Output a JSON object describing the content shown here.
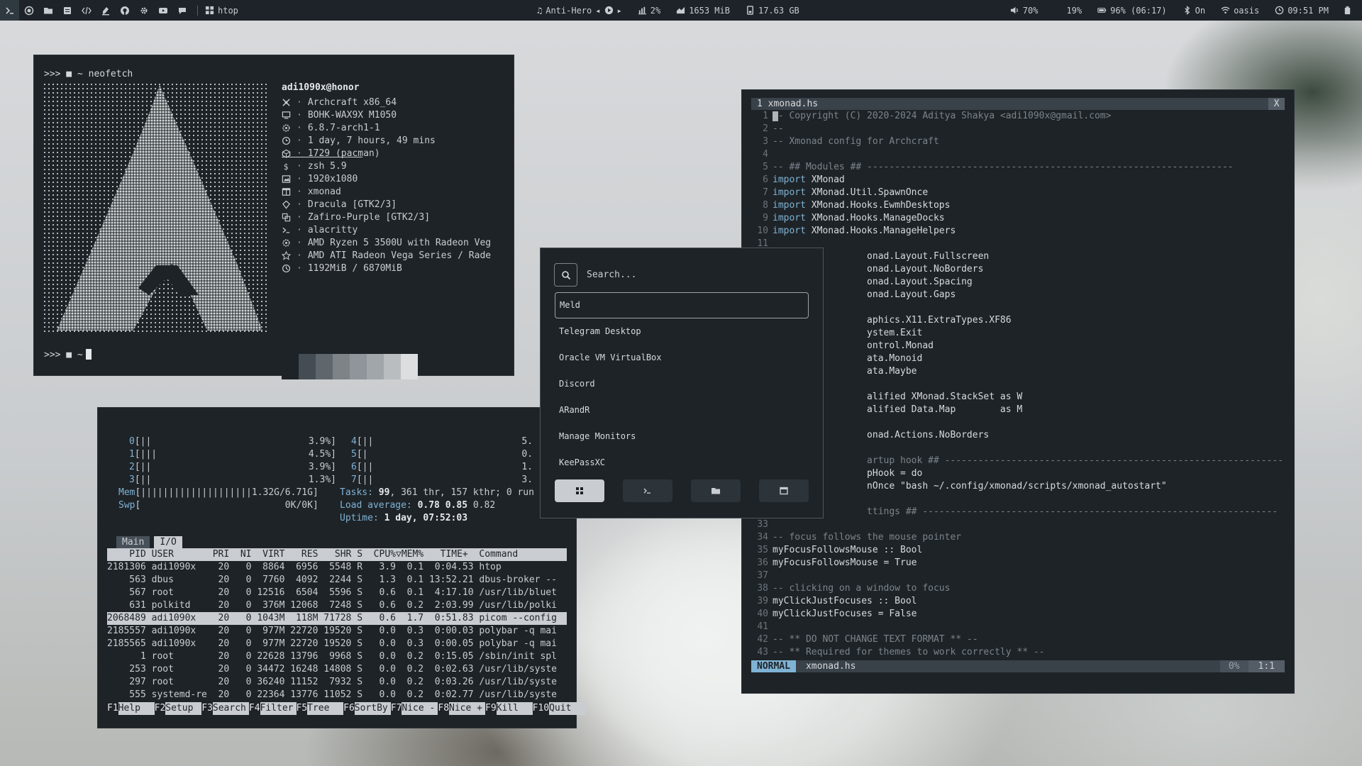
{
  "topbar": {
    "workspace_label": "htop",
    "music_track": "Anti-Hero",
    "cpu": "2%",
    "memory": "1653 MiB",
    "disk": "17.63 GB",
    "volume": "70%",
    "brightness": "19%",
    "battery": "96% (06:17)",
    "bluetooth": "On",
    "wifi": "oasis",
    "clock": "09:51 PM"
  },
  "neofetch": {
    "prompt_cmd": ">>> ■ ~ neofetch",
    "prompt_after": ">>> ■ ~",
    "user_host": "adi1090x@honor",
    "info": [
      {
        "icon": "os-icon",
        "value": "Archcraft x86_64"
      },
      {
        "icon": "host-icon",
        "value": "BOHK-WAX9X M1050"
      },
      {
        "icon": "kernel-icon",
        "value": "6.8.7-arch1-1"
      },
      {
        "icon": "uptime-icon",
        "value": "1 day, 7 hours, 49 mins"
      },
      {
        "icon": "packages-icon",
        "value": "1729 (pacman)"
      },
      {
        "icon": "shell-icon",
        "value": "zsh 5.9"
      },
      {
        "icon": "resolution-icon",
        "value": "1920x1080"
      },
      {
        "icon": "wm-icon",
        "value": "xmonad"
      },
      {
        "icon": "theme-icon",
        "value": "Dracula [GTK2/3]"
      },
      {
        "icon": "icons-icon",
        "value": "Zafiro-Purple [GTK2/3]"
      },
      {
        "icon": "terminal-icon",
        "value": "alacritty"
      },
      {
        "icon": "cpu-icon",
        "value": "AMD Ryzen 5 3500U with Radeon Veg"
      },
      {
        "icon": "gpu-icon",
        "value": "AMD ATI Radeon Vega Series / Rade"
      },
      {
        "icon": "memory-icon",
        "value": "1192MiB / 6870MiB"
      }
    ],
    "palette": [
      "#1e2327",
      "#454d54",
      "#5f676d",
      "#7d8387",
      "#8f959b",
      "#a1a6aa",
      "#babdbf",
      "#dcdedf"
    ]
  },
  "htop": {
    "cpus_left": [
      {
        "id": "0",
        "bar": "[||",
        "pct": "3.9%]"
      },
      {
        "id": "1",
        "bar": "[|||",
        "pct": "4.5%]"
      },
      {
        "id": "2",
        "bar": "[||",
        "pct": "3.9%]"
      },
      {
        "id": "3",
        "bar": "[||",
        "pct": "1.3%]"
      }
    ],
    "cpus_right": [
      {
        "id": "4",
        "bar": "[||",
        "pct": "5."
      },
      {
        "id": "5",
        "bar": "[|",
        "pct": "0."
      },
      {
        "id": "6",
        "bar": "[||",
        "pct": "1."
      },
      {
        "id": "7",
        "bar": "[||",
        "pct": "3."
      }
    ],
    "mem_label": "Mem",
    "mem_bar": "[||||||||||||||||||||1.32G/6.71G]",
    "swp_label": "Swp",
    "swp_bar": "[                          0K/0K]",
    "tasks_label": "Tasks:",
    "tasks_count": "99",
    "tasks_rest": ", 361 thr, 157 kthr; 0 run",
    "load_label": "Load average:",
    "load_1": "0.78",
    "load_5": "0.85",
    "load_15": "0.82",
    "uptime_label": "Uptime:",
    "uptime_value": "1 day, 07:52:03",
    "tab_main": "Main",
    "tab_io": "I/O",
    "header": "    PID USER       PRI  NI  VIRT   RES   SHR S  CPU%▽MEM%   TIME+  Command",
    "processes": [
      "2181306 adi1090x    20   0  8864  6956  5548 R   3.9  0.1  0:04.53 htop",
      "    563 dbus        20   0  7760  4092  2244 S   1.3  0.1 13:52.21 dbus-broker --",
      "    567 root        20   0 12516  6504  5596 S   0.6  0.1  4:17.10 /usr/lib/bluet",
      "    631 polkitd     20   0  376M 12068  7248 S   0.6  0.2  2:03.99 /usr/lib/polki",
      "2068489 adi1090x    20   0 1043M  118M 71728 S   0.6  1.7  0:51.83 picom --config",
      "2185557 adi1090x    20   0  977M 22720 19520 S   0.0  0.3  0:00.03 polybar -q mai",
      "2185565 adi1090x    20   0  977M 22720 19520 S   0.0  0.3  0:00.05 polybar -q mai",
      "      1 root        20   0 22628 13796  9968 S   0.0  0.2  0:15.05 /sbin/init spl",
      "    253 root        20   0 34472 16248 14808 S   0.0  0.2  0:02.63 /usr/lib/syste",
      "    297 root        20   0 36240 11152  7932 S   0.0  0.2  0:03.26 /usr/lib/syste",
      "    555 systemd-re  20   0 22364 13776 11052 S   0.0  0.2  0:02.77 /usr/lib/syste"
    ],
    "selected_index": 4,
    "fkeys": [
      {
        "key": "F1",
        "label": "Help  "
      },
      {
        "key": "F2",
        "label": "Setup "
      },
      {
        "key": "F3",
        "label": "Search"
      },
      {
        "key": "F4",
        "label": "Filter"
      },
      {
        "key": "F5",
        "label": "Tree  "
      },
      {
        "key": "F6",
        "label": "SortBy"
      },
      {
        "key": "F7",
        "label": "Nice -"
      },
      {
        "key": "F8",
        "label": "Nice +"
      },
      {
        "key": "F9",
        "label": "Kill  "
      },
      {
        "key": "F10",
        "label": "Quit  "
      }
    ]
  },
  "editor": {
    "tab_label": "1 xmonad.hs",
    "close_label": "X",
    "lines": [
      {
        "n": "1",
        "text": "-- Copyright (C) 2020-2024 Aditya Shakya <adi1090x@gmail.com>",
        "t": "cm"
      },
      {
        "n": "2",
        "text": "--",
        "t": "cm"
      },
      {
        "n": "3",
        "text": "-- Xmonad config for Archcraft",
        "t": "cm"
      },
      {
        "n": "4",
        "text": "",
        "t": "id"
      },
      {
        "n": "5",
        "text": "-- ## Modules ## ------------------------------------------------------------------",
        "t": "cm"
      },
      {
        "n": "6",
        "text": "import XMonad",
        "t": "imp"
      },
      {
        "n": "7",
        "text": "import XMonad.Util.SpawnOnce",
        "t": "imp"
      },
      {
        "n": "8",
        "text": "import XMonad.Hooks.EwmhDesktops",
        "t": "imp"
      },
      {
        "n": "9",
        "text": "import XMonad.Hooks.ManageDocks",
        "t": "imp"
      },
      {
        "n": "10",
        "text": "import XMonad.Hooks.ManageHelpers",
        "t": "imp"
      },
      {
        "n": "11",
        "text": "",
        "t": "id"
      },
      {
        "n": "",
        "text": "                 onad.Layout.Fullscreen",
        "t": "id"
      },
      {
        "n": "",
        "text": "                 onad.Layout.NoBorders",
        "t": "id"
      },
      {
        "n": "",
        "text": "                 onad.Layout.Spacing",
        "t": "id"
      },
      {
        "n": "",
        "text": "                 onad.Layout.Gaps",
        "t": "id"
      },
      {
        "n": "",
        "text": "",
        "t": "id"
      },
      {
        "n": "",
        "text": "                 aphics.X11.ExtraTypes.XF86",
        "t": "id"
      },
      {
        "n": "",
        "text": "                 ystem.Exit",
        "t": "id"
      },
      {
        "n": "",
        "text": "                 ontrol.Monad",
        "t": "id"
      },
      {
        "n": "",
        "text": "                 ata.Monoid",
        "t": "id"
      },
      {
        "n": "",
        "text": "                 ata.Maybe",
        "t": "id"
      },
      {
        "n": "",
        "text": "",
        "t": "id"
      },
      {
        "n": "",
        "text": "                 alified XMonad.StackSet as W",
        "t": "id"
      },
      {
        "n": "",
        "text": "                 alified Data.Map        as M",
        "t": "id"
      },
      {
        "n": "",
        "text": "",
        "t": "id"
      },
      {
        "n": "",
        "text": "                 onad.Actions.NoBorders",
        "t": "id"
      },
      {
        "n": "",
        "text": "",
        "t": "id"
      },
      {
        "n": "",
        "text": "                 artup hook ## -------------------------------------------------------------",
        "t": "cm"
      },
      {
        "n": "",
        "text": "                 pHook = do",
        "t": "id"
      },
      {
        "n": "",
        "text": "                 nOnce \"bash ~/.config/xmonad/scripts/xmonad_autostart\"",
        "t": "id"
      },
      {
        "n": "",
        "text": "",
        "t": "id"
      },
      {
        "n": "",
        "text": "                 ttings ## ----------------------------------------------------------------",
        "t": "cm"
      },
      {
        "n": "33",
        "text": "",
        "t": "id"
      },
      {
        "n": "34",
        "text": "-- focus follows the mouse pointer",
        "t": "cm"
      },
      {
        "n": "35",
        "text": "myFocusFollowsMouse :: Bool",
        "t": "id"
      },
      {
        "n": "36",
        "text": "myFocusFollowsMouse = True",
        "t": "id"
      },
      {
        "n": "37",
        "text": "",
        "t": "id"
      },
      {
        "n": "38",
        "text": "-- clicking on a window to focus",
        "t": "cm"
      },
      {
        "n": "39",
        "text": "myClickJustFocuses :: Bool",
        "t": "id"
      },
      {
        "n": "40",
        "text": "myClickJustFocuses = False",
        "t": "id"
      },
      {
        "n": "41",
        "text": "",
        "t": "id"
      },
      {
        "n": "42",
        "text": "-- ** DO NOT CHANGE TEXT FORMAT ** --",
        "t": "cm"
      },
      {
        "n": "43",
        "text": "-- ** Required for themes to work correctly ** --",
        "t": "cm"
      }
    ],
    "mode": "NORMAL",
    "filename": "xmonad.hs",
    "percent": "0%",
    "position": "1:1"
  },
  "launcher": {
    "search_placeholder": "Search...",
    "items": [
      "Meld",
      "Telegram Desktop",
      "Oracle VM VirtualBox",
      "Discord",
      "ARandR",
      "Manage Monitors",
      "KeePassXC"
    ],
    "selected_index": 0,
    "modes": [
      {
        "icon": "apps-grid-icon",
        "active": true
      },
      {
        "icon": "terminal-icon",
        "active": false
      },
      {
        "icon": "folder-icon",
        "active": false
      },
      {
        "icon": "window-icon",
        "active": false
      }
    ]
  }
}
